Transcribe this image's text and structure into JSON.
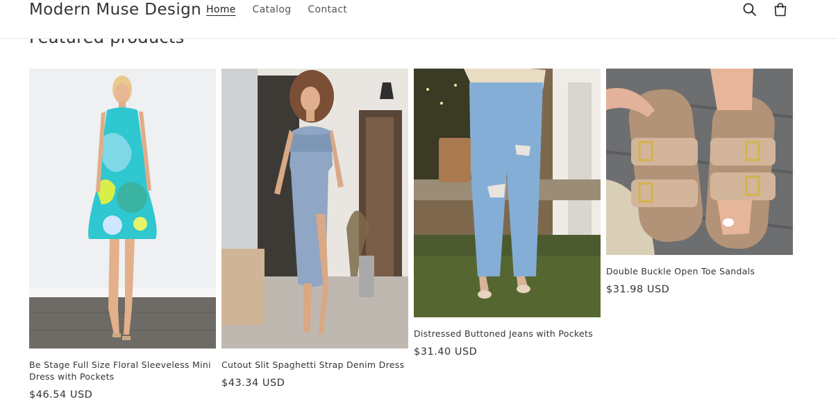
{
  "header": {
    "brand": "Modern Muse Design",
    "nav": [
      "Home",
      "Catalog",
      "Contact"
    ],
    "icons": [
      "search-icon",
      "cart-icon"
    ]
  },
  "section": {
    "title": "Featured products"
  },
  "products": [
    {
      "title": "Be Stage Full Size Floral Sleeveless Mini Dress with Pockets",
      "price": "$46.54 USD"
    },
    {
      "title": "Cutout Slit Spaghetti Strap Denim Dress",
      "price": "$43.34 USD"
    },
    {
      "title": "Distressed Buttoned Jeans with Pockets",
      "price": "$31.40 USD"
    },
    {
      "title": "Double Buckle Open Toe Sandals",
      "price": "$31.98 USD"
    }
  ]
}
